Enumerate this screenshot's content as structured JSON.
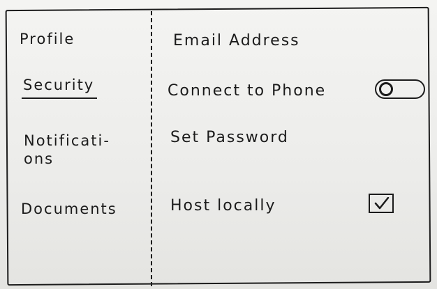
{
  "sidebar": {
    "items": [
      {
        "label": "Profile",
        "selected": false
      },
      {
        "label": "Security",
        "selected": true
      },
      {
        "label_line1": "Notificati-",
        "label_line2": "ons",
        "selected": false
      },
      {
        "label": "Documents",
        "selected": false
      }
    ]
  },
  "settings": {
    "email": {
      "label": "Email Address"
    },
    "phone": {
      "label": "Connect to Phone",
      "toggle_on": false,
      "icon": "toggle-switch-icon"
    },
    "password": {
      "label": "Set Password"
    },
    "host": {
      "label": "Host locally",
      "checked": true,
      "icon": "checkbox-checked-icon"
    }
  },
  "colors": {
    "ink": "#1b1b1b",
    "paper": "#f0f0ee"
  }
}
